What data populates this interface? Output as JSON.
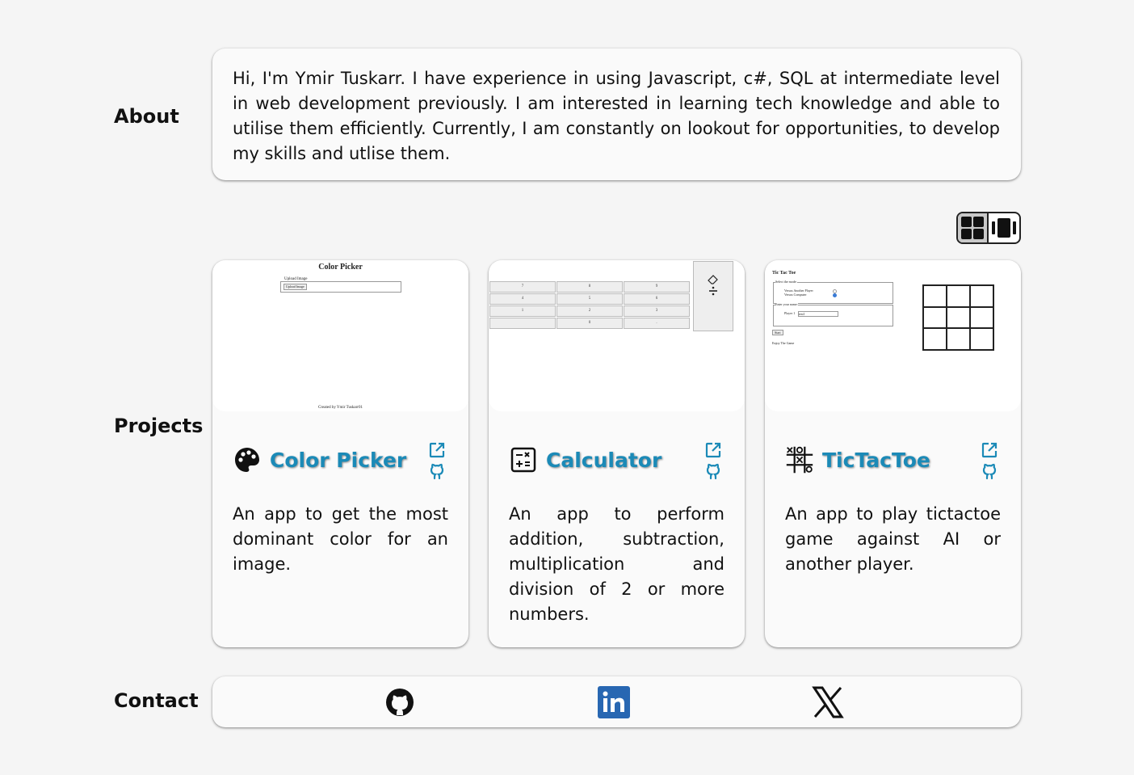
{
  "sections": {
    "about": "About",
    "projects": "Projects",
    "contact": "Contact"
  },
  "about": {
    "text": "Hi, I'm Ymir Tuskarr. I have experience in using Javascript, c#, SQL at intermediate level in web development previously. I am interested in learning tech knowledge and able to utilise them efficiently. Currently, I am constantly on lookout for opportunities, to develop my skills and utlise them."
  },
  "view_toggle": {
    "icons": [
      "grid-view-icon",
      "carousel-view-icon"
    ],
    "selected": "grid"
  },
  "projects": [
    {
      "title": "Color Picker",
      "icon": "palette-icon",
      "description": "An app to get the most dominant color for an image.",
      "preview": {
        "heading": "Color Picker",
        "fieldset_legend": "Upload Image",
        "button": "Upload Image",
        "footer": "Created by Ymir Tuskarr01"
      }
    },
    {
      "title": "Calculator",
      "icon": "calculator-icon",
      "description": "An app to perform addition, subtraction, multiplication and division of 2 or more numbers.",
      "preview": {
        "keys": [
          "7",
          "8",
          "9",
          "4",
          "5",
          "6",
          "1",
          "2",
          "3",
          "",
          "0",
          "."
        ]
      }
    },
    {
      "title": "TicTacToe",
      "icon": "tictactoe-icon",
      "description": "An app to play tictactoe game against AI or another player.",
      "preview": {
        "heading": "Tic Tac Toe",
        "mode_legend": "Select the mode:",
        "option_1": "Versus Another Player",
        "option_2": "Versus Computer",
        "name_legend": "Enter your name:",
        "name_label": "Player 1",
        "name_value": "test1",
        "start_button": "Start",
        "footer": "Enjoy The Game"
      }
    }
  ],
  "link_icons": [
    "external-link-icon",
    "github-icon"
  ],
  "contact": {
    "icons": [
      "github-icon",
      "linkedin-icon",
      "x-icon"
    ]
  },
  "colors": {
    "accent": "#1b8ab7",
    "background": "#f5f5f5",
    "panel": "#fafafa",
    "linkedin": "#2867b2"
  }
}
